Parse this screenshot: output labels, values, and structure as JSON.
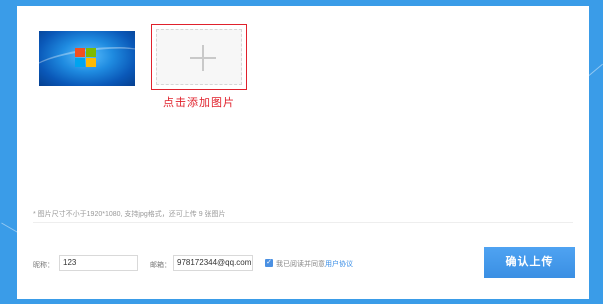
{
  "upload": {
    "add_label": "点击添加图片"
  },
  "hint": "* 图片尺寸不小于1920*1080, 支持jpg格式，还可上传 9 张图片",
  "form": {
    "nickname_label": "昵称：",
    "nickname_value": "123",
    "email_label": "邮箱：",
    "email_value": "978172344@qq.com",
    "agree_text": "我已阅读并同意",
    "agree_link": "用户协议",
    "agree_check": "✓"
  },
  "submit_label": "确认上传",
  "colors": {
    "accent_red": "#e0212c",
    "button_blue": "#3a8fe3",
    "background": "#3a9ce8"
  }
}
